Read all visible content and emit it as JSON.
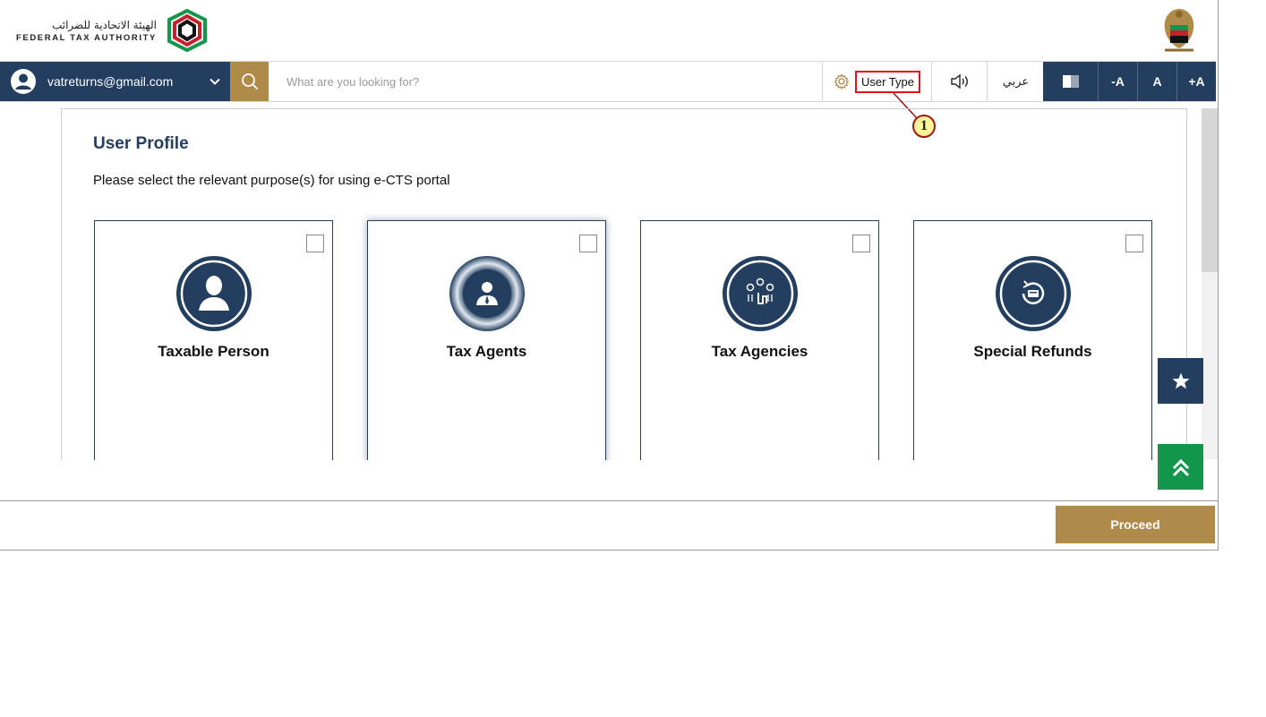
{
  "header": {
    "logo_arabic": "الهيئة الاتحادية للضرائب",
    "logo_english": "FEDERAL TAX AUTHORITY"
  },
  "navbar": {
    "account_email": "vatreturns@gmail.com",
    "search_placeholder": "What are you looking for?",
    "user_type_label": "User Type",
    "arabic_label": "عربي",
    "font_decrease": "-A",
    "font_normal": "A",
    "font_increase": "+A"
  },
  "callout": {
    "number": "1"
  },
  "main": {
    "title": "User Profile",
    "instruction": "Please select the relevant purpose(s) for using e-CTS portal",
    "cards": [
      {
        "label": "Taxable Person",
        "icon": "person-icon",
        "checked": false
      },
      {
        "label": "Tax Agents",
        "icon": "agent-icon",
        "checked": false
      },
      {
        "label": "Tax Agencies",
        "icon": "agencies-icon",
        "checked": false
      },
      {
        "label": "Special Refunds",
        "icon": "refund-icon",
        "checked": false
      }
    ]
  },
  "footer": {
    "proceed_label": "Proceed"
  },
  "colors": {
    "navy": "#233e5f",
    "gold": "#b08a48",
    "green": "#12964b",
    "callout_red": "#e0141e"
  }
}
